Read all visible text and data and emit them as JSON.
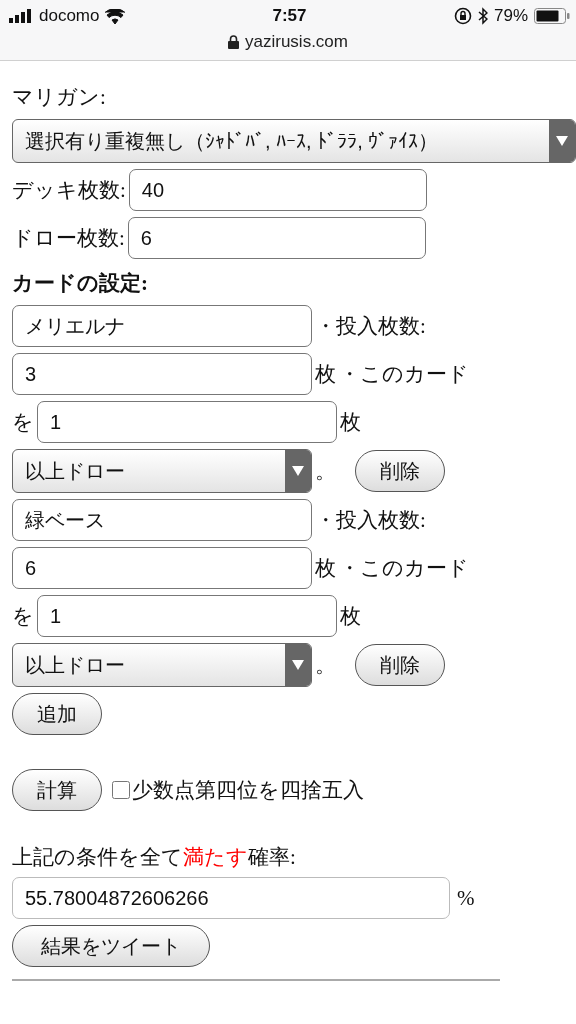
{
  "status_bar": {
    "carrier": "docomo",
    "time": "7:57",
    "battery": "79%",
    "url": "yazirusis.com"
  },
  "mulligan": {
    "label": "マリガン:",
    "value": "選択有り重複無し（ｼｬﾄﾞﾊﾞ, ﾊｰｽ, ﾄﾞﾗﾗ, ｳﾞｧｲｽ）"
  },
  "deck": {
    "label": "デッキ枚数:",
    "value": "40"
  },
  "draw": {
    "label": "ドロー枚数:",
    "value": "6"
  },
  "cards_heading": "カードの設定:",
  "cards": [
    {
      "name": "メリエルナ",
      "count_label": "・投入枚数:",
      "count": "3",
      "unit": "枚",
      "this_card": "・このカード",
      "wo": "を",
      "need": "1",
      "need_unit": "枚",
      "condition": "以上ドロー",
      "period": "。",
      "delete": "削除"
    },
    {
      "name": "緑ベース",
      "count_label": "・投入枚数:",
      "count": "6",
      "unit": "枚",
      "this_card": "・このカード",
      "wo": "を",
      "need": "1",
      "need_unit": "枚",
      "condition": "以上ドロー",
      "period": "。",
      "delete": "削除"
    }
  ],
  "add_button": "追加",
  "calc_button": "計算",
  "round_option": {
    "label": "少数点第四位を四捨五入",
    "checked": false
  },
  "result_label": {
    "before": "上記の条件を全て",
    "highlight": "満たす",
    "after": "確率:"
  },
  "result": {
    "value": "55.78004872606266",
    "unit": "%"
  },
  "tweet_button": "結果をツイート"
}
